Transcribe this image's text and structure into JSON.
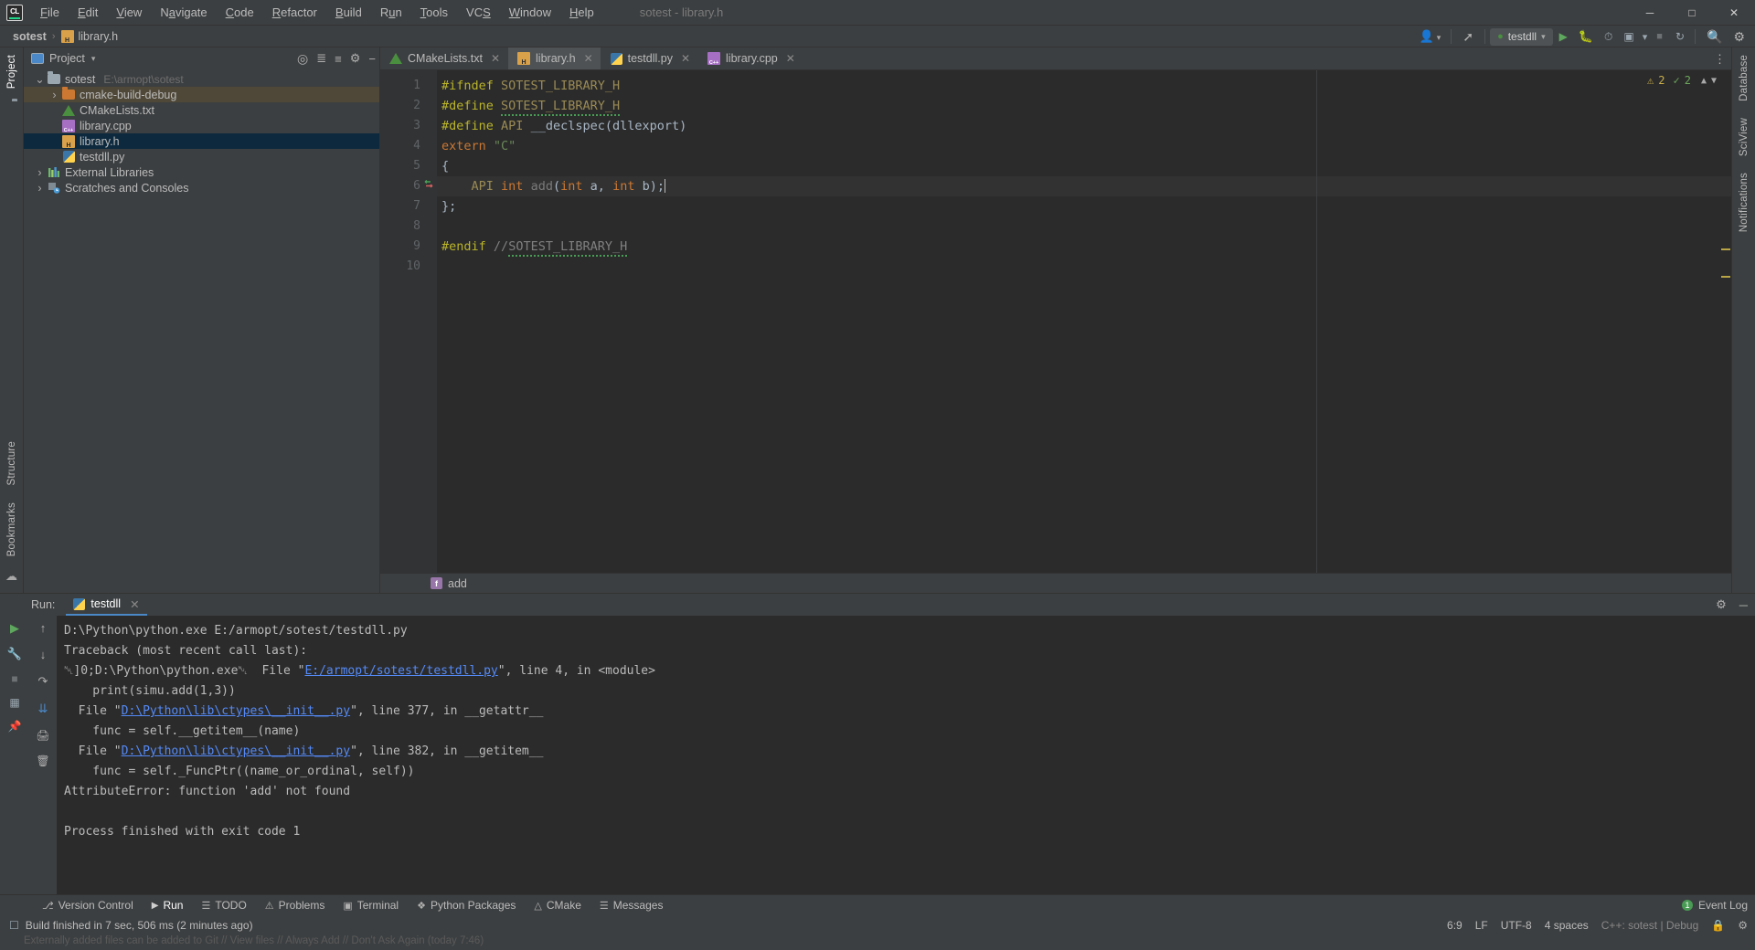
{
  "window": {
    "title": "sotest - library.h",
    "minimize": "─",
    "maximize": "□",
    "close": "✕",
    "logo_text": "CL"
  },
  "menu": {
    "items": [
      {
        "label": "File"
      },
      {
        "label": "Edit"
      },
      {
        "label": "View"
      },
      {
        "label": "Navigate"
      },
      {
        "label": "Code"
      },
      {
        "label": "Refactor"
      },
      {
        "label": "Build"
      },
      {
        "label": "Run"
      },
      {
        "label": "Tools"
      },
      {
        "label": "VCS"
      },
      {
        "label": "Window"
      },
      {
        "label": "Help"
      }
    ]
  },
  "navbar": {
    "crumbs": [
      "sotest",
      "library.h"
    ],
    "separator": "›",
    "run_config": "testdll",
    "icons": {
      "account": "account-icon",
      "search_everywhere": "search-everywhere-icon",
      "run": "▶",
      "debug": "debug-icon",
      "profile": "profile-icon",
      "coverage": "coverage-icon",
      "more": "⋯",
      "stop": "■",
      "update": "update-icon",
      "search": "⌕",
      "settings": "⚙"
    }
  },
  "left_rail": {
    "top_label": "Project",
    "bottom_labels": [
      "Structure",
      "Bookmarks"
    ],
    "favorites_icon": "folder-icon",
    "commit_icon": "commit-icon"
  },
  "right_rail": {
    "labels": [
      "Database",
      "SciView",
      "Notifications"
    ]
  },
  "project_panel": {
    "title": "Project",
    "dropdown": "▾",
    "actions": [
      "locate-icon",
      "collapse-all-icon",
      "expand-icon",
      "settings-icon",
      "hide-icon"
    ],
    "tree": [
      {
        "indent": 0,
        "twisty": "⌄",
        "icon": "folder-icon",
        "label": "sotest",
        "path": "E:\\armopt\\sotest",
        "state": "normal"
      },
      {
        "indent": 1,
        "twisty": "›",
        "icon": "folder-orange-icon",
        "label": "cmake-build-debug",
        "path": "",
        "state": "brown"
      },
      {
        "indent": 1,
        "twisty": "",
        "icon": "cmake-icon",
        "label": "CMakeLists.txt",
        "path": "",
        "state": "normal"
      },
      {
        "indent": 1,
        "twisty": "",
        "icon": "cpp-file-icon",
        "label": "library.cpp",
        "path": "",
        "state": "normal"
      },
      {
        "indent": 1,
        "twisty": "",
        "icon": "header-file-icon",
        "label": "library.h",
        "path": "",
        "state": "blue"
      },
      {
        "indent": 1,
        "twisty": "",
        "icon": "python-file-icon",
        "label": "testdll.py",
        "path": "",
        "state": "normal"
      },
      {
        "indent": 0,
        "twisty": "›",
        "icon": "libraries-icon",
        "label": "External Libraries",
        "path": "",
        "state": "normal"
      },
      {
        "indent": 0,
        "twisty": "›",
        "icon": "scratches-icon",
        "label": "Scratches and Consoles",
        "path": "",
        "state": "normal"
      }
    ]
  },
  "editor": {
    "tabs": [
      {
        "label": "CMakeLists.txt",
        "icon": "cmake-icon",
        "active": false
      },
      {
        "label": "library.h",
        "icon": "header-file-icon",
        "active": true
      },
      {
        "label": "testdll.py",
        "icon": "python-file-icon",
        "active": false
      },
      {
        "label": "library.cpp",
        "icon": "cpp-file-icon",
        "active": false
      }
    ],
    "tab_close": "✕",
    "gutter_lines": [
      "1",
      "2",
      "3",
      "4",
      "5",
      "6",
      "7",
      "8",
      "9",
      "10"
    ],
    "inspections": {
      "warnings": "2",
      "ok": "2",
      "warn_icon": "⚠",
      "ok_icon": "✓",
      "up": "⌃",
      "down": "⌄"
    },
    "code_lines": [
      {
        "n": 1,
        "text": "#ifndef SOTEST_LIBRARY_H"
      },
      {
        "n": 2,
        "text": "#define SOTEST_LIBRARY_H"
      },
      {
        "n": 3,
        "text": "#define API __declspec(dllexport)"
      },
      {
        "n": 4,
        "text": "extern \"C\""
      },
      {
        "n": 5,
        "text": "{"
      },
      {
        "n": 6,
        "text": "    API int add(int a, int b);"
      },
      {
        "n": 7,
        "text": "};"
      },
      {
        "n": 8,
        "text": ""
      },
      {
        "n": 9,
        "text": "#endif //SOTEST_LIBRARY_H"
      },
      {
        "n": 10,
        "text": ""
      }
    ],
    "breadcrumb_symbol": "add",
    "breadcrumb_symbol_kind": "f"
  },
  "run_window": {
    "run_label": "Run:",
    "tab_label": "testdll",
    "tab_close": "✕",
    "settings_icon": "⚙",
    "hide_icon": "─",
    "gutter_icons": [
      "rerun-icon",
      "wrench-icon",
      "stop-icon",
      "layout-icon",
      "pin-icon"
    ],
    "gutter2_icons": [
      "up-arrow-icon",
      "down-arrow-icon",
      "soft-wrap-icon",
      "scroll-to-end-icon",
      "print-icon",
      "trash-icon"
    ],
    "console": [
      {
        "type": "plain",
        "text": "D:\\Python\\python.exe E:/armopt/sotest/testdll.py"
      },
      {
        "type": "plain",
        "text": "Traceback (most recent call last):"
      },
      {
        "type": "mixed",
        "pre": "␀]0;D:\\Python\\python.exe␀  File \"",
        "link": "E:/armopt/sotest/testdll.py",
        "post": "\", line 4, in <module>"
      },
      {
        "type": "plain",
        "text": "    print(simu.add(1,3))"
      },
      {
        "type": "mixed",
        "pre": "  File \"",
        "link": "D:\\Python\\lib\\ctypes\\__init__.py",
        "post": "\", line 377, in __getattr__"
      },
      {
        "type": "plain",
        "text": "    func = self.__getitem__(name)"
      },
      {
        "type": "mixed",
        "pre": "  File \"",
        "link": "D:\\Python\\lib\\ctypes\\__init__.py",
        "post": "\", line 382, in __getitem__"
      },
      {
        "type": "plain",
        "text": "    func = self._FuncPtr((name_or_ordinal, self))"
      },
      {
        "type": "plain",
        "text": "AttributeError: function 'add' not found"
      },
      {
        "type": "plain",
        "text": ""
      },
      {
        "type": "plain",
        "text": "Process finished with exit code 1"
      }
    ]
  },
  "bottom_tabs": {
    "items": [
      {
        "label": "Version Control",
        "icon": "branch-icon",
        "active": false
      },
      {
        "label": "Run",
        "icon": "run-icon",
        "active": true
      },
      {
        "label": "TODO",
        "icon": "todo-icon",
        "active": false
      },
      {
        "label": "Problems",
        "icon": "problems-icon",
        "active": false
      },
      {
        "label": "Terminal",
        "icon": "terminal-icon",
        "active": false
      },
      {
        "label": "Python Packages",
        "icon": "packages-icon",
        "active": false
      },
      {
        "label": "CMake",
        "icon": "cmake-icon",
        "active": false
      },
      {
        "label": "Messages",
        "icon": "messages-icon",
        "active": false
      }
    ],
    "event_log": "Event Log",
    "event_badge": "1"
  },
  "statusbar": {
    "message": "Build finished in 7 sec, 506 ms (2 minutes ago)",
    "caret": "6:9",
    "line_sep": "LF",
    "encoding": "UTF-8",
    "indent": "4 spaces",
    "profile": "C++: sotest | Debug",
    "lock_icon": "lock-icon",
    "inspect_icon": "inspection-icon"
  },
  "tip": {
    "text": "Externally added files can be added to Git // View files // Always Add // Don't Ask Again (today 7:46)"
  },
  "colors": {
    "background": "#3c3f41",
    "editor_bg": "#2b2b2b",
    "selection_blue": "#0d293e",
    "selection_brown": "#4f4838",
    "accent_link": "#548af7",
    "keyword": "#cc7832",
    "preprocessor": "#bbb529",
    "string": "#6a8759",
    "plain_code": "#a9b7c6",
    "tab_active": "#4e5254",
    "green_ok": "#499c54",
    "warn_yellow": "#c9ae4a"
  }
}
